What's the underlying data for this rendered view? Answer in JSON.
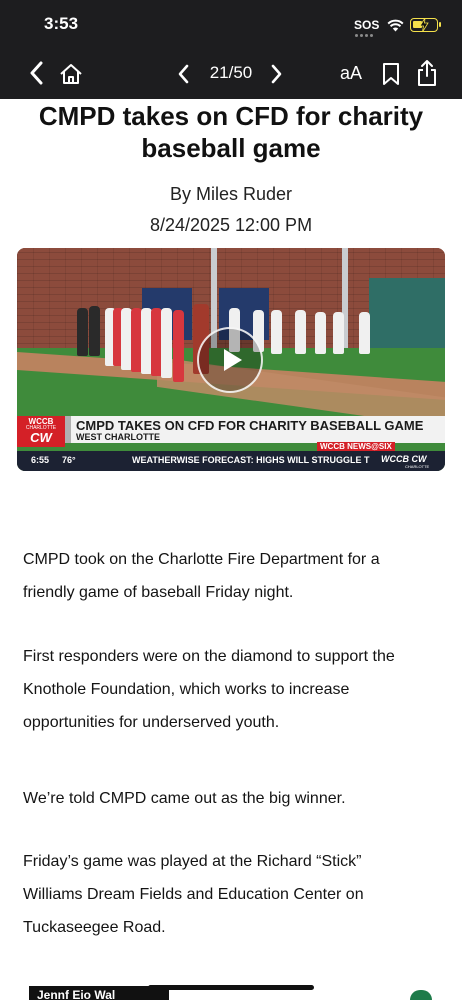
{
  "status_bar": {
    "time": "3:53",
    "sos": "SOS",
    "battery_color": "#f5e14b"
  },
  "nav": {
    "back_icon": "chevron-left-icon",
    "home_icon": "home-icon",
    "prev_icon": "chevron-left-icon",
    "page_counter": "21/50",
    "next_icon": "chevron-right-icon",
    "text_size_label": "aA",
    "bookmark_icon": "bookmark-icon",
    "share_icon": "share-icon"
  },
  "article": {
    "headline_line1": "CMPD takes on CFD for charity",
    "headline_line2": "baseball game",
    "byline": "By Miles Ruder",
    "date": "8/24/2025 12:00 PM",
    "paragraphs": [
      [
        "CMPD took on the Charlotte Fire Department for a",
        "friendly game of baseball Friday night."
      ],
      [
        "First responders were on the diamond to support the",
        "Knothole Foundation, which works to increase",
        "opportunities for underserved youth."
      ],
      [
        "We’re told CMPD came out as the big winner."
      ],
      [
        "Friday’s game was played at the Richard “Stick”",
        "Williams Dream Fields and Education Center on",
        "Tuckaseegee Road."
      ]
    ]
  },
  "video": {
    "play_icon": "play-icon",
    "station_logo_top": "WCCB",
    "station_logo_mid": "CHARLOTTE",
    "station_logo_bottom": "CW",
    "lower_third_title": "CMPD TAKES ON CFD FOR CHARITY BASEBALL GAME",
    "lower_third_location": "WEST CHARLOTTE",
    "news_tag": "WCCB NEWS@SIX",
    "ticker_time": "6:55",
    "ticker_temp": "76°",
    "ticker_text": "WEATHERWISE FORECAST: HIGHS WILL STRUGGLE T",
    "ticker_logo": "WCCB CW",
    "ticker_logo_sub": "CHARLOTTE"
  },
  "ad": {
    "text": "Jennf Eio Wal"
  }
}
